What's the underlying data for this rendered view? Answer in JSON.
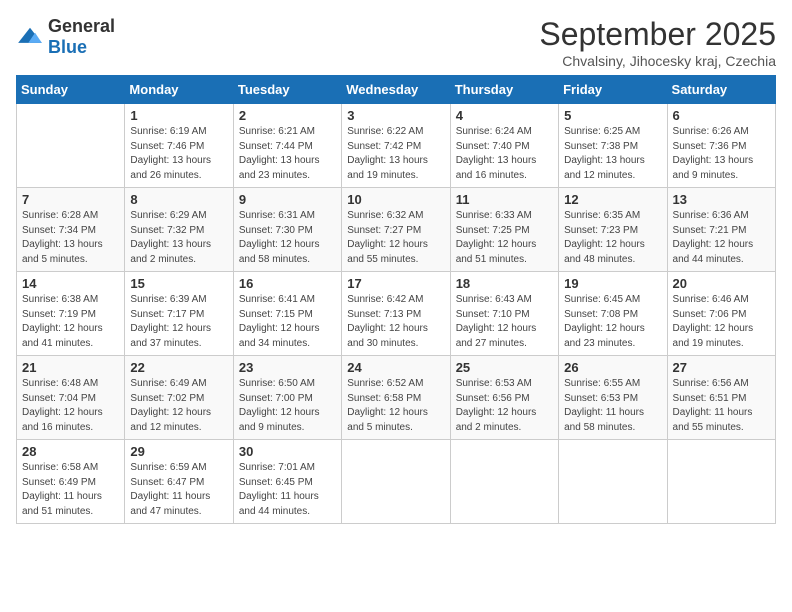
{
  "logo": {
    "general": "General",
    "blue": "Blue"
  },
  "title": "September 2025",
  "subtitle": "Chvalsiny, Jihocesky kraj, Czechia",
  "weekdays": [
    "Sunday",
    "Monday",
    "Tuesday",
    "Wednesday",
    "Thursday",
    "Friday",
    "Saturday"
  ],
  "weeks": [
    [
      {
        "day": "",
        "info": ""
      },
      {
        "day": "1",
        "info": "Sunrise: 6:19 AM\nSunset: 7:46 PM\nDaylight: 13 hours\nand 26 minutes."
      },
      {
        "day": "2",
        "info": "Sunrise: 6:21 AM\nSunset: 7:44 PM\nDaylight: 13 hours\nand 23 minutes."
      },
      {
        "day": "3",
        "info": "Sunrise: 6:22 AM\nSunset: 7:42 PM\nDaylight: 13 hours\nand 19 minutes."
      },
      {
        "day": "4",
        "info": "Sunrise: 6:24 AM\nSunset: 7:40 PM\nDaylight: 13 hours\nand 16 minutes."
      },
      {
        "day": "5",
        "info": "Sunrise: 6:25 AM\nSunset: 7:38 PM\nDaylight: 13 hours\nand 12 minutes."
      },
      {
        "day": "6",
        "info": "Sunrise: 6:26 AM\nSunset: 7:36 PM\nDaylight: 13 hours\nand 9 minutes."
      }
    ],
    [
      {
        "day": "7",
        "info": "Sunrise: 6:28 AM\nSunset: 7:34 PM\nDaylight: 13 hours\nand 5 minutes."
      },
      {
        "day": "8",
        "info": "Sunrise: 6:29 AM\nSunset: 7:32 PM\nDaylight: 13 hours\nand 2 minutes."
      },
      {
        "day": "9",
        "info": "Sunrise: 6:31 AM\nSunset: 7:30 PM\nDaylight: 12 hours\nand 58 minutes."
      },
      {
        "day": "10",
        "info": "Sunrise: 6:32 AM\nSunset: 7:27 PM\nDaylight: 12 hours\nand 55 minutes."
      },
      {
        "day": "11",
        "info": "Sunrise: 6:33 AM\nSunset: 7:25 PM\nDaylight: 12 hours\nand 51 minutes."
      },
      {
        "day": "12",
        "info": "Sunrise: 6:35 AM\nSunset: 7:23 PM\nDaylight: 12 hours\nand 48 minutes."
      },
      {
        "day": "13",
        "info": "Sunrise: 6:36 AM\nSunset: 7:21 PM\nDaylight: 12 hours\nand 44 minutes."
      }
    ],
    [
      {
        "day": "14",
        "info": "Sunrise: 6:38 AM\nSunset: 7:19 PM\nDaylight: 12 hours\nand 41 minutes."
      },
      {
        "day": "15",
        "info": "Sunrise: 6:39 AM\nSunset: 7:17 PM\nDaylight: 12 hours\nand 37 minutes."
      },
      {
        "day": "16",
        "info": "Sunrise: 6:41 AM\nSunset: 7:15 PM\nDaylight: 12 hours\nand 34 minutes."
      },
      {
        "day": "17",
        "info": "Sunrise: 6:42 AM\nSunset: 7:13 PM\nDaylight: 12 hours\nand 30 minutes."
      },
      {
        "day": "18",
        "info": "Sunrise: 6:43 AM\nSunset: 7:10 PM\nDaylight: 12 hours\nand 27 minutes."
      },
      {
        "day": "19",
        "info": "Sunrise: 6:45 AM\nSunset: 7:08 PM\nDaylight: 12 hours\nand 23 minutes."
      },
      {
        "day": "20",
        "info": "Sunrise: 6:46 AM\nSunset: 7:06 PM\nDaylight: 12 hours\nand 19 minutes."
      }
    ],
    [
      {
        "day": "21",
        "info": "Sunrise: 6:48 AM\nSunset: 7:04 PM\nDaylight: 12 hours\nand 16 minutes."
      },
      {
        "day": "22",
        "info": "Sunrise: 6:49 AM\nSunset: 7:02 PM\nDaylight: 12 hours\nand 12 minutes."
      },
      {
        "day": "23",
        "info": "Sunrise: 6:50 AM\nSunset: 7:00 PM\nDaylight: 12 hours\nand 9 minutes."
      },
      {
        "day": "24",
        "info": "Sunrise: 6:52 AM\nSunset: 6:58 PM\nDaylight: 12 hours\nand 5 minutes."
      },
      {
        "day": "25",
        "info": "Sunrise: 6:53 AM\nSunset: 6:56 PM\nDaylight: 12 hours\nand 2 minutes."
      },
      {
        "day": "26",
        "info": "Sunrise: 6:55 AM\nSunset: 6:53 PM\nDaylight: 11 hours\nand 58 minutes."
      },
      {
        "day": "27",
        "info": "Sunrise: 6:56 AM\nSunset: 6:51 PM\nDaylight: 11 hours\nand 55 minutes."
      }
    ],
    [
      {
        "day": "28",
        "info": "Sunrise: 6:58 AM\nSunset: 6:49 PM\nDaylight: 11 hours\nand 51 minutes."
      },
      {
        "day": "29",
        "info": "Sunrise: 6:59 AM\nSunset: 6:47 PM\nDaylight: 11 hours\nand 47 minutes."
      },
      {
        "day": "30",
        "info": "Sunrise: 7:01 AM\nSunset: 6:45 PM\nDaylight: 11 hours\nand 44 minutes."
      },
      {
        "day": "",
        "info": ""
      },
      {
        "day": "",
        "info": ""
      },
      {
        "day": "",
        "info": ""
      },
      {
        "day": "",
        "info": ""
      }
    ]
  ]
}
